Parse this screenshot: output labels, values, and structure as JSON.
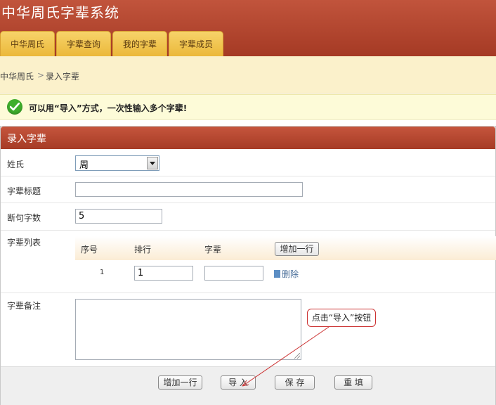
{
  "header": {
    "title": "中华周氏字辈系统"
  },
  "tabs": [
    {
      "label": "中华周氏"
    },
    {
      "label": "字辈查询"
    },
    {
      "label": "我的字辈"
    },
    {
      "label": "字辈成员"
    }
  ],
  "breadcrumb": {
    "root": "中华周氏",
    "separator": ">",
    "current": "录入字辈"
  },
  "notice": {
    "text": "可以用“导入”方式，一次性输入多个字辈!"
  },
  "panel": {
    "title": "录入字辈"
  },
  "form": {
    "surname_label": "姓氏",
    "surname_value": "周",
    "title_label": "字辈标题",
    "title_value": "",
    "chars_label": "断句字数",
    "chars_value": "5",
    "list_label": "字辈列表",
    "note_label": "字辈备注",
    "note_value": ""
  },
  "subtable": {
    "headers": [
      "序号",
      "排行",
      "字辈"
    ],
    "add_row_label": "增加一行",
    "rows": [
      {
        "index": "1",
        "rank": "1",
        "generation": "",
        "delete_label": "删除"
      }
    ]
  },
  "footer": {
    "add_row_label": "增加一行",
    "import_label": "导 入",
    "save_label": "保 存",
    "reset_label": "重 填"
  },
  "callout": {
    "text": "点击“导入”按钮"
  },
  "colors": {
    "brand": "#b4462e",
    "tab": "#f2c44f",
    "notice_bg": "#fdfbd8",
    "success": "#3eae2c"
  },
  "icons": [
    "check-circle-icon",
    "trash-icon",
    "chevron-down-icon"
  ]
}
